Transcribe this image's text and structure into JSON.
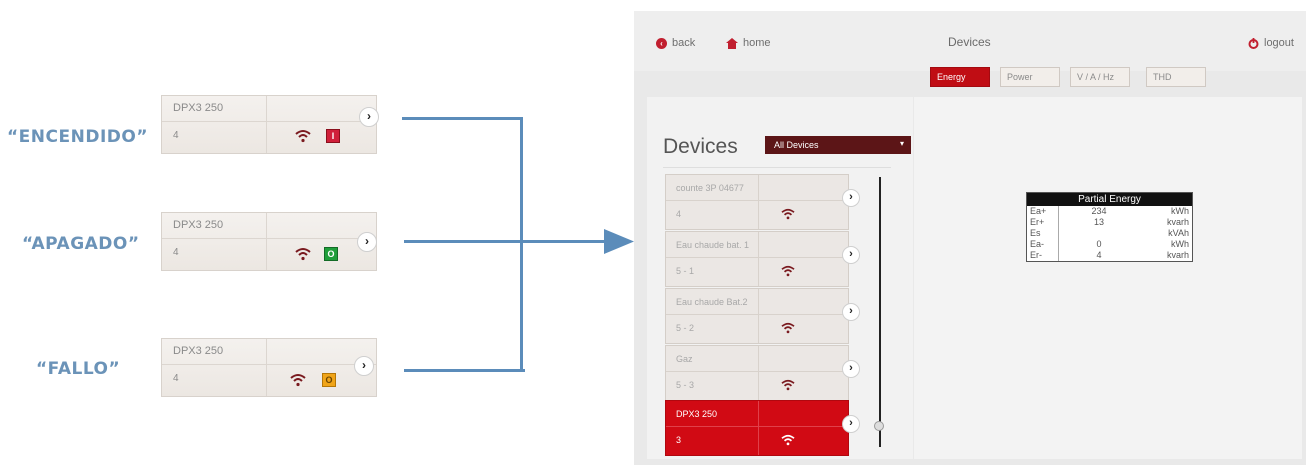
{
  "states": [
    {
      "label": "“ENCENDIDO”",
      "name": "DPX3 250",
      "num": "4",
      "status_symbol": "I",
      "status_color": "#d0203a"
    },
    {
      "label": "“APAGADO”",
      "name": "DPX3 250",
      "num": "4",
      "status_symbol": "O",
      "status_color": "#1f9e3a"
    },
    {
      "label": "“FALLO”",
      "name": "DPX3 250",
      "num": "4",
      "status_symbol": "O",
      "status_color": "#f0a418"
    }
  ],
  "colors": {
    "connector": "#5b8cba",
    "accent_red": "#c00d14",
    "wifi": "#7a1a1f"
  },
  "screen": {
    "nav": {
      "back": "back",
      "home": "home",
      "title": "Devices",
      "logout": "logout"
    },
    "tabs": [
      "Energy",
      "Power",
      "V / A / Hz",
      "THD"
    ],
    "active_tab": "Energy",
    "devices_title": "Devices",
    "filter_value": "All Devices",
    "devices": [
      {
        "name": "counte 3P 04677",
        "num": "4",
        "selected": false
      },
      {
        "name": "Eau chaude bat. 1",
        "num": "5 - 1",
        "selected": false
      },
      {
        "name": "Eau chaude Bat.2",
        "num": "5 - 2",
        "selected": false
      },
      {
        "name": "Gaz",
        "num": "5 - 3",
        "selected": false
      },
      {
        "name": "DPX3 250",
        "num": "3",
        "selected": true
      }
    ],
    "partial_energy": {
      "title": "Partial Energy",
      "rows": [
        {
          "key": "Ea+",
          "value": "234",
          "unit": "kWh"
        },
        {
          "key": "Er+",
          "value": "13",
          "unit": "kvarh"
        },
        {
          "key": "Es",
          "value": "",
          "unit": "kVAh"
        },
        {
          "key": "Ea-",
          "value": "0",
          "unit": "kWh"
        },
        {
          "key": "Er-",
          "value": "4",
          "unit": "kvarh"
        }
      ]
    }
  }
}
